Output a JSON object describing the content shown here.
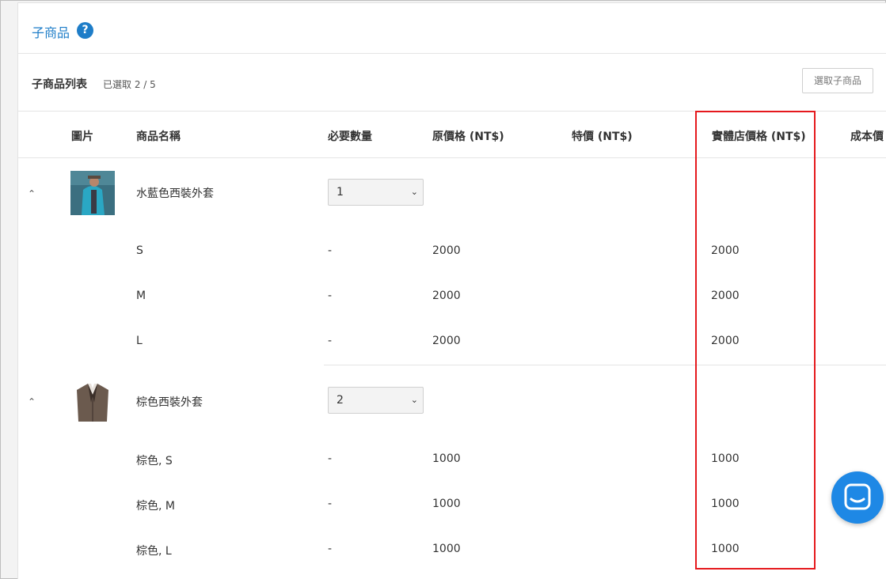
{
  "section": {
    "title": "子商品",
    "help_icon": "question-circle-icon"
  },
  "list": {
    "title": "子商品列表",
    "count": "已選取 2 / 5",
    "select_button": "選取子商品"
  },
  "columns": {
    "image": "圖片",
    "name": "商品名稱",
    "required_qty": "必要數量",
    "original_price": "原價格 (NT$)",
    "special_price": "特價 (NT$)",
    "store_price": "實體店價格 (NT$)",
    "cost_price": "成本價"
  },
  "products": [
    {
      "name": "水藍色西裝外套",
      "qty": "1",
      "thumb_colors": [
        "#2aa7c4",
        "#5a4a3f"
      ],
      "variants": [
        {
          "name": "S",
          "required": "-",
          "original": "2000",
          "store": "2000"
        },
        {
          "name": "M",
          "required": "-",
          "original": "2000",
          "store": "2000"
        },
        {
          "name": "L",
          "required": "-",
          "original": "2000",
          "store": "2000"
        }
      ]
    },
    {
      "name": "棕色西裝外套",
      "qty": "2",
      "thumb_colors": [
        "#6b5a4e",
        "#3b2f29"
      ],
      "variants": [
        {
          "name": "棕色, S",
          "required": "-",
          "original": "1000",
          "store": "1000"
        },
        {
          "name": "棕色, M",
          "required": "-",
          "original": "1000",
          "store": "1000"
        },
        {
          "name": "棕色, L",
          "required": "-",
          "original": "1000",
          "store": "1000"
        }
      ]
    }
  ],
  "colors": {
    "accent": "#1e7dc8",
    "highlight": "#e5191d",
    "chat": "#1e88e5"
  },
  "chat_icon": "chat-bubble-icon"
}
